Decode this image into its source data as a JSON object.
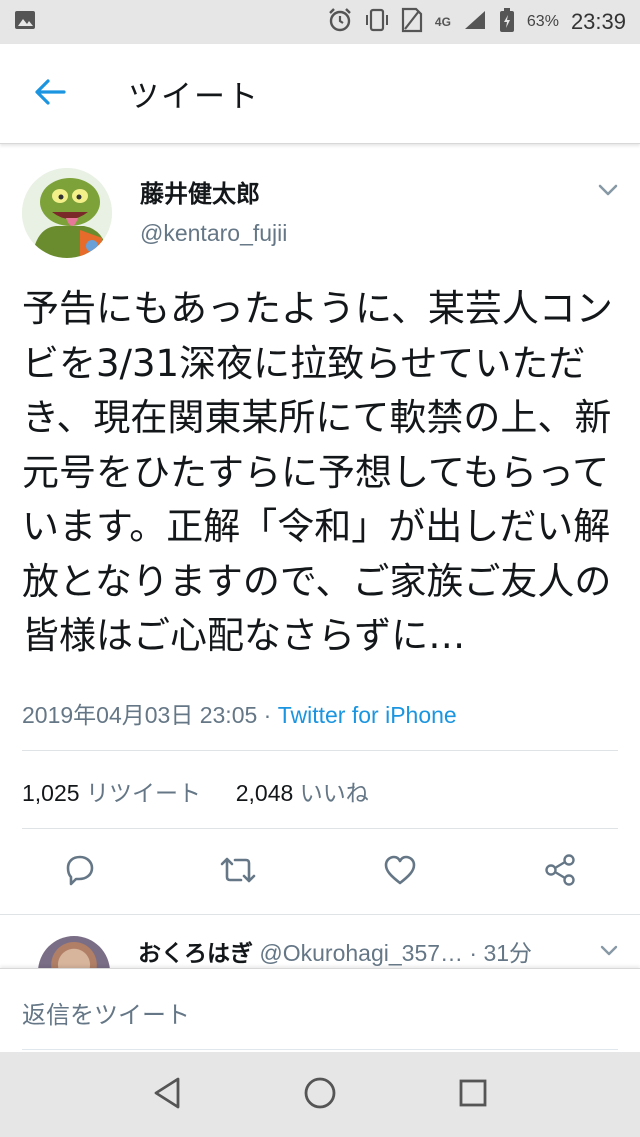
{
  "status_bar": {
    "network": "4G",
    "battery": "63%",
    "time": "23:39"
  },
  "header": {
    "title": "ツイート"
  },
  "tweet": {
    "display_name": "藤井健太郎",
    "handle": "@kentaro_fujii",
    "text": "予告にもあったように、某芸人コンビを3/31深夜に拉致らせていただき、現在関東某所にて軟禁の上、新元号をひたすらに予想してもらっています。正解「令和」が出しだい解放となりますので、ご家族ご友人の皆様はご心配なさらずに…",
    "timestamp": "2019年04月03日 23:05",
    "separator": " · ",
    "source": "Twitter for iPhone",
    "retweet_count": "1,025",
    "retweet_label": "リツイート",
    "like_count": "2,048",
    "like_label": "いいね"
  },
  "reply_preview": {
    "name": "おくろはぎ",
    "handle": "@Okurohagi_357…",
    "time": " · 31分"
  },
  "compose": {
    "placeholder": "返信をツイート"
  },
  "colors": {
    "accent": "#1b95e0",
    "secondary_text": "#657786",
    "primary_text": "#14171a"
  }
}
